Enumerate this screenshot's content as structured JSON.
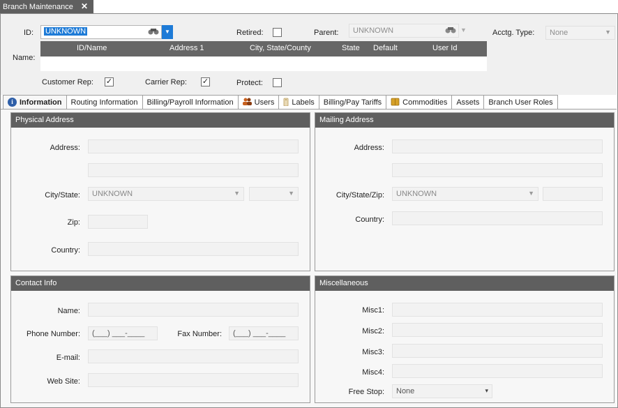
{
  "doc_tab": {
    "title": "Branch Maintenance",
    "close": "✕"
  },
  "header": {
    "id_label": "ID:",
    "id_value": "UNKNOWN",
    "retired_label": "Retired:",
    "parent_label": "Parent:",
    "parent_value": "UNKNOWN",
    "acctg_label": "Acctg. Type:",
    "acctg_value": "None",
    "name_label": "Name:",
    "grid_columns": [
      "ID/Name",
      "Address 1",
      "City, State/County",
      "State",
      "Default",
      "User Id"
    ],
    "customer_rep_label": "Customer Rep:",
    "customer_rep_checked": "✓",
    "carrier_rep_label": "Carrier Rep:",
    "carrier_rep_checked": "✓",
    "protect_label": "Protect:"
  },
  "tabs": [
    {
      "label": "Information"
    },
    {
      "label": "Routing Information"
    },
    {
      "label": "Billing/Payroll Information"
    },
    {
      "label": "Users"
    },
    {
      "label": "Labels"
    },
    {
      "label": "Billing/Pay Tariffs"
    },
    {
      "label": "Commodities"
    },
    {
      "label": "Assets"
    },
    {
      "label": "Branch User Roles"
    }
  ],
  "physical": {
    "title": "Physical Address",
    "address_label": "Address:",
    "city_label": "City/State:",
    "city_value": "UNKNOWN",
    "zip_label": "Zip:",
    "country_label": "Country:"
  },
  "mailing": {
    "title": "Mailing Address",
    "address_label": "Address:",
    "city_label": "City/State/Zip:",
    "city_value": "UNKNOWN",
    "country_label": "Country:"
  },
  "contact": {
    "title": "Contact Info",
    "name_label": "Name:",
    "phone_label": "Phone Number:",
    "phone_placeholder": "(___) ___-____",
    "fax_label": "Fax Number:",
    "fax_placeholder": "(___) ___-____",
    "email_label": "E-mail:",
    "web_label": "Web Site:"
  },
  "misc": {
    "title": "Miscellaneous",
    "misc1_label": "Misc1:",
    "misc2_label": "Misc2:",
    "misc3_label": "Misc3:",
    "misc4_label": "Misc4:",
    "free_stop_label": "Free Stop:",
    "free_stop_value": "None"
  },
  "colors": {
    "accent": "#1e7bd7",
    "header_dark": "#5f5f5f"
  }
}
